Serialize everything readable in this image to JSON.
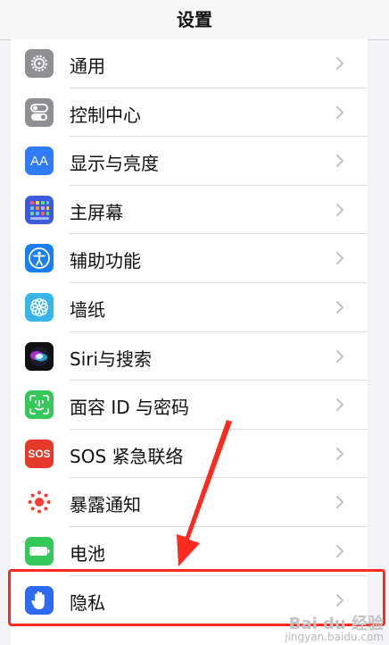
{
  "nav": {
    "title": "设置"
  },
  "rows": [
    {
      "label": "通用",
      "icon": "gear-icon",
      "color": "#8e8e93"
    },
    {
      "label": "控制中心",
      "icon": "toggles-icon",
      "color": "#8e8e93"
    },
    {
      "label": "显示与亮度",
      "icon": "text-size-icon",
      "color": "#2f7cf6",
      "glyph": "AA"
    },
    {
      "label": "主屏幕",
      "icon": "home-screen-grid-icon",
      "color": "#3b5bdb"
    },
    {
      "label": "辅助功能",
      "icon": "accessibility-icon",
      "color": "#1a7ff5"
    },
    {
      "label": "墙纸",
      "icon": "wallpaper-flower-icon",
      "color": "#38b6e8"
    },
    {
      "label": "Siri与搜索",
      "icon": "siri-icon",
      "color": "#111111"
    },
    {
      "label": "面容 ID 与密码",
      "icon": "face-id-icon",
      "color": "#34c759"
    },
    {
      "label": "SOS 紧急联络",
      "icon": "sos-icon",
      "color": "#e5392c",
      "glyph": "SOS"
    },
    {
      "label": "暴露通知",
      "icon": "exposure-notification-icon",
      "color": "#ffffff"
    },
    {
      "label": "电池",
      "icon": "battery-icon",
      "color": "#34c759"
    },
    {
      "label": "隐私",
      "icon": "privacy-hand-icon",
      "color": "#2f6bf0"
    }
  ],
  "annotation": {
    "highlight_color": "#ff2a1f"
  },
  "watermark": {
    "brand": "Bai du 经验",
    "url": "jingyan.baidu.com"
  }
}
